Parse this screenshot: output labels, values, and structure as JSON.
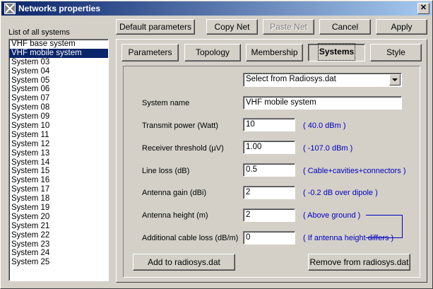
{
  "window": {
    "title": "Networks properties"
  },
  "list": {
    "label": "List of all systems",
    "items": [
      "VHF base system",
      "VHF mobile system",
      "System 03",
      "System 04",
      "System 05",
      "System 06",
      "System 07",
      "System 08",
      "System 09",
      "System 10",
      "System 11",
      "System 12",
      "System 13",
      "System 14",
      "System 15",
      "System 16",
      "System 17",
      "System 18",
      "System 19",
      "System 20",
      "System 21",
      "System 22",
      "System 23",
      "System 24",
      "System 25"
    ],
    "selected_index": 1
  },
  "toolbar": {
    "default_parameters": "Default parameters",
    "copy_net": "Copy Net",
    "paste_net": "Paste Net",
    "cancel": "Cancel",
    "apply": "Apply"
  },
  "tabs": [
    "Parameters",
    "Topology",
    "Membership",
    "Systems",
    "Style"
  ],
  "active_tab": "Systems",
  "form": {
    "select_value": "Select from Radiosys.dat",
    "system_name_label": "System name",
    "system_name_value": "VHF mobile system",
    "transmit_power_label": "Transmit power (Watt)",
    "transmit_power_value": "10",
    "transmit_power_hint": "( 40.0 dBm )",
    "receiver_threshold_label": "Receiver threshold (µV)",
    "receiver_threshold_value": "1.00",
    "receiver_threshold_hint": "( -107.0 dBm )",
    "line_loss_label": "Line loss (dB)",
    "line_loss_value": "0.5",
    "line_loss_hint": "( Cable+cavities+connectors )",
    "antenna_gain_label": "Antenna gain (dBi)",
    "antenna_gain_value": "2",
    "antenna_gain_hint": "( -0.2 dB over dipole )",
    "antenna_height_label": "Antenna height (m)",
    "antenna_height_value": "2",
    "antenna_height_hint": "( Above ground )",
    "additional_loss_label": "Additional cable loss (dB/m)",
    "additional_loss_value": "0",
    "additional_loss_hint": "( If antenna height differs )",
    "add_button": "Add to radiosys.dat",
    "remove_button": "Remove from radiosys.dat"
  },
  "colors": {
    "title_start": "#0a246a",
    "title_end": "#a6caf0",
    "hint": "#0000c0",
    "selection": "#0a246a"
  }
}
